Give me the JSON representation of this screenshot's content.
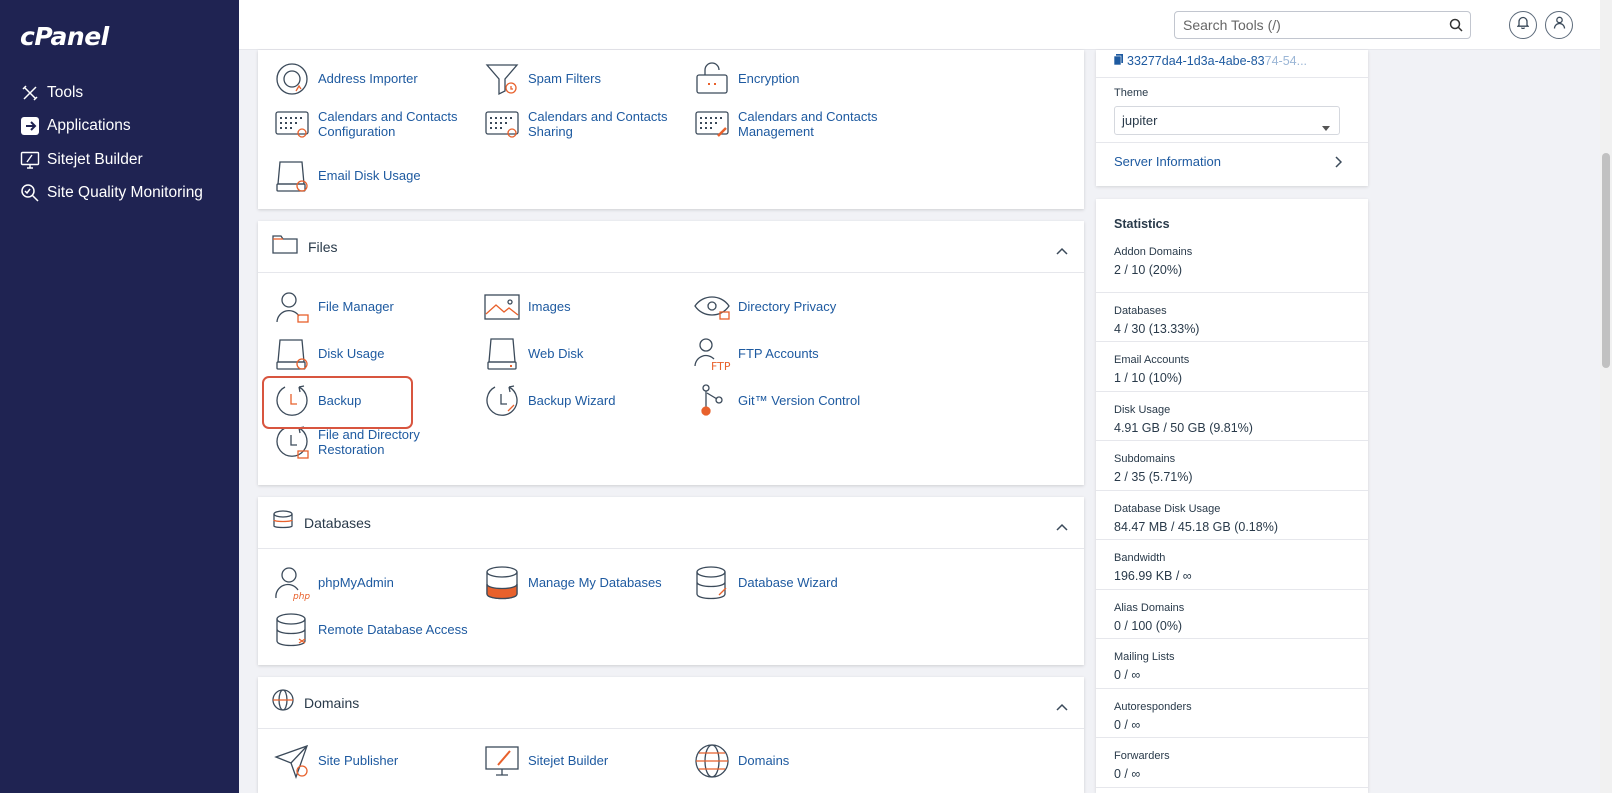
{
  "app": {
    "logo": "cPanel"
  },
  "sidebar": {
    "items": [
      {
        "label": "Tools",
        "icon": "tools-icon"
      },
      {
        "label": "Applications",
        "icon": "applications-icon"
      },
      {
        "label": "Sitejet Builder",
        "icon": "sitejet-icon"
      },
      {
        "label": "Site Quality Monitoring",
        "icon": "site-quality-icon"
      }
    ]
  },
  "topbar": {
    "search_placeholder": "Search Tools (/)"
  },
  "email_panel": {
    "items": [
      {
        "label": "Address Importer"
      },
      {
        "label": "Spam Filters"
      },
      {
        "label": "Encryption"
      },
      {
        "label": "Calendars and Contacts Configuration"
      },
      {
        "label": "Calendars and Contacts Sharing"
      },
      {
        "label": "Calendars and Contacts Management"
      },
      {
        "label": "Email Disk Usage"
      }
    ]
  },
  "files_panel": {
    "title": "Files",
    "items": [
      {
        "label": "File Manager"
      },
      {
        "label": "Images"
      },
      {
        "label": "Directory Privacy"
      },
      {
        "label": "Disk Usage"
      },
      {
        "label": "Web Disk"
      },
      {
        "label": "FTP Accounts"
      },
      {
        "label": "Backup"
      },
      {
        "label": "Backup Wizard"
      },
      {
        "label": "Git™ Version Control"
      },
      {
        "label": "File and Directory Restoration"
      }
    ]
  },
  "databases_panel": {
    "title": "Databases",
    "items": [
      {
        "label": "phpMyAdmin"
      },
      {
        "label": "Manage My Databases"
      },
      {
        "label": "Database Wizard"
      },
      {
        "label": "Remote Database Access"
      }
    ]
  },
  "domains_panel": {
    "title": "Domains",
    "items": [
      {
        "label": "Site Publisher"
      },
      {
        "label": "Sitejet Builder"
      },
      {
        "label": "Domains"
      }
    ]
  },
  "general_info": {
    "key_id": "33277da4-1d3a-4abe-83",
    "key_id_faded": "74-54...",
    "theme_label": "Theme",
    "theme_value": "jupiter",
    "server_info": "Server Information"
  },
  "statistics": {
    "title": "Statistics",
    "rows": [
      {
        "label": "Addon Domains",
        "value": "2 / 10   (20%)"
      },
      {
        "label": "Databases",
        "value": "4 / 30   (13.33%)"
      },
      {
        "label": "Email Accounts",
        "value": "1 / 10   (10%)"
      },
      {
        "label": "Disk Usage",
        "value": "4.91 GB / 50 GB   (9.81%)"
      },
      {
        "label": "Subdomains",
        "value": "2 / 35   (5.71%)"
      },
      {
        "label": "Database Disk Usage",
        "value": "84.47 MB / 45.18 GB   (0.18%)"
      },
      {
        "label": "Bandwidth",
        "value": "196.99 KB / ∞"
      },
      {
        "label": "Alias Domains",
        "value": "0 / 100   (0%)"
      },
      {
        "label": "Mailing Lists",
        "value": "0 / ∞"
      },
      {
        "label": "Autoresponders",
        "value": "0 / ∞"
      },
      {
        "label": "Forwarders",
        "value": "0 / ∞"
      }
    ]
  },
  "colors": {
    "sidebar": "#1f2352",
    "link": "#1e5aa0",
    "accent": "#e8612c",
    "highlight": "#d8553f"
  }
}
